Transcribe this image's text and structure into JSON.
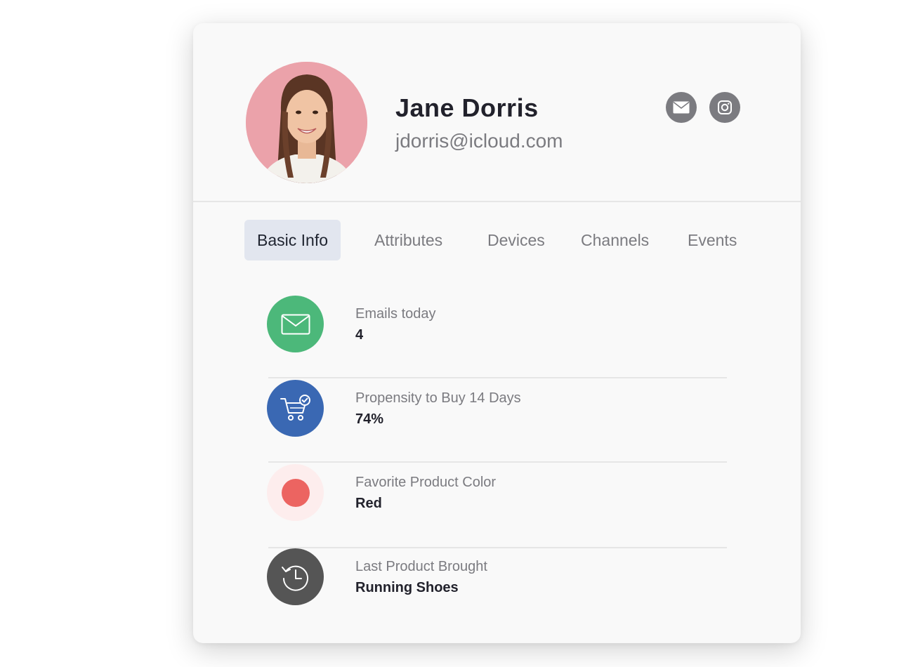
{
  "profile": {
    "name": "Jane Dorris",
    "email": "jdorris@icloud.com",
    "avatar_bg": "#eba2aa",
    "social_icons": [
      "mail-icon",
      "instagram-icon"
    ]
  },
  "tabs": [
    {
      "label": "Basic Info",
      "active": true
    },
    {
      "label": "Attributes",
      "active": false
    },
    {
      "label": "Devices",
      "active": false
    },
    {
      "label": "Channels",
      "active": false
    },
    {
      "label": "Events",
      "active": false
    }
  ],
  "info_rows": [
    {
      "label": "Emails today",
      "value": "4",
      "icon": "envelope-icon",
      "color": "#4cb87a"
    },
    {
      "label": "Propensity to Buy 14 Days",
      "value": "74%",
      "icon": "cart-check-icon",
      "color": "#3a68b3"
    },
    {
      "label": "Favorite Product Color",
      "value": "Red",
      "icon": "color-dot-icon",
      "color": "#ec6461"
    },
    {
      "label": "Last Product Brought",
      "value": "Running Shoes",
      "icon": "history-clock-icon",
      "color": "#555555"
    }
  ]
}
